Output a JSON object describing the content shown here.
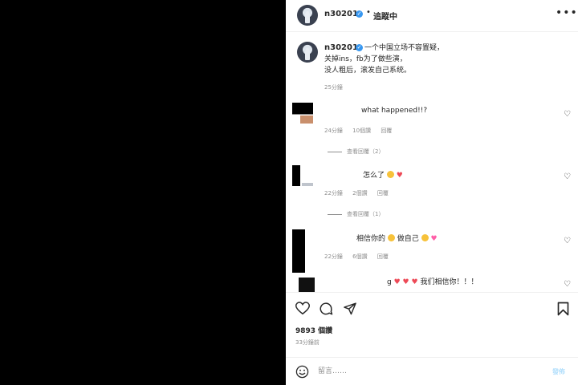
{
  "header": {
    "username": "n30201",
    "verified_mark": "✓",
    "separator": "•",
    "follow_status": "追蹤中",
    "more_icon": "more-icon"
  },
  "caption": {
    "username": "n30201",
    "lines": [
      "一个中国立场不容置疑，",
      "关掉ins，fb为了做些演，",
      "没人粗后，滚发自己系统。"
    ],
    "time": "25分鐘"
  },
  "comments": [
    {
      "text": "what happened!!?",
      "meta": [
        "24分鐘",
        "10個讚",
        "回覆"
      ],
      "replies_label": "查看回覆（2）"
    },
    {
      "text": "怎么了",
      "meta": [
        "22分鐘",
        "2個讚",
        "回覆"
      ],
      "replies_label": "查看回覆（1）"
    },
    {
      "text": "相信你的",
      "text2": "做自己",
      "meta": [
        "22分鐘",
        "6個讚",
        "回覆"
      ]
    },
    {
      "text_start": "g",
      "text_end": "我们相信你！！！"
    }
  ],
  "actions": {
    "like_icon": "heart-icon",
    "comment_icon": "comment-icon",
    "share_icon": "share-icon",
    "save_icon": "bookmark-icon"
  },
  "likes": "9893 個讚",
  "post_time": "33分鐘前",
  "composer": {
    "placeholder": "留言……",
    "post_label": "發佈"
  },
  "colors": {
    "verified": "#3897f0",
    "heart": "#ed4956",
    "muted": "#8e8e8e",
    "post_disabled": "#b2dffc"
  }
}
